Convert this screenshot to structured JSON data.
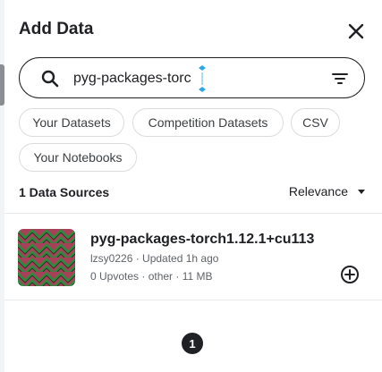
{
  "panel": {
    "title": "Add Data",
    "close_icon": "close-icon"
  },
  "search": {
    "value": "pyg-packages-torc",
    "placeholder": "Search datasets",
    "icon": "search-icon",
    "filter_icon": "filter-icon"
  },
  "chips": [
    {
      "label": "Your Datasets"
    },
    {
      "label": "Competition Datasets"
    },
    {
      "label": "CSV"
    },
    {
      "label": "Your Notebooks"
    }
  ],
  "results": {
    "count_label": "1 Data Sources",
    "sort_label": "Relevance"
  },
  "items": [
    {
      "title": "pyg-packages-torch1.12.1+cu113",
      "meta": "lzsy0226 · Updated 1h ago",
      "stats": "0 Upvotes · other · 11 MB",
      "add_icon": "add-circle-icon"
    }
  ],
  "pagination": {
    "current_page": "1"
  },
  "colors": {
    "text": "#202124",
    "border": "#dadce0",
    "thumb_red": "#a8405a",
    "thumb_green": "#2e8b3e",
    "thumb_dark": "#1b2a1d",
    "cursor_blue": "#2aa8e8"
  }
}
